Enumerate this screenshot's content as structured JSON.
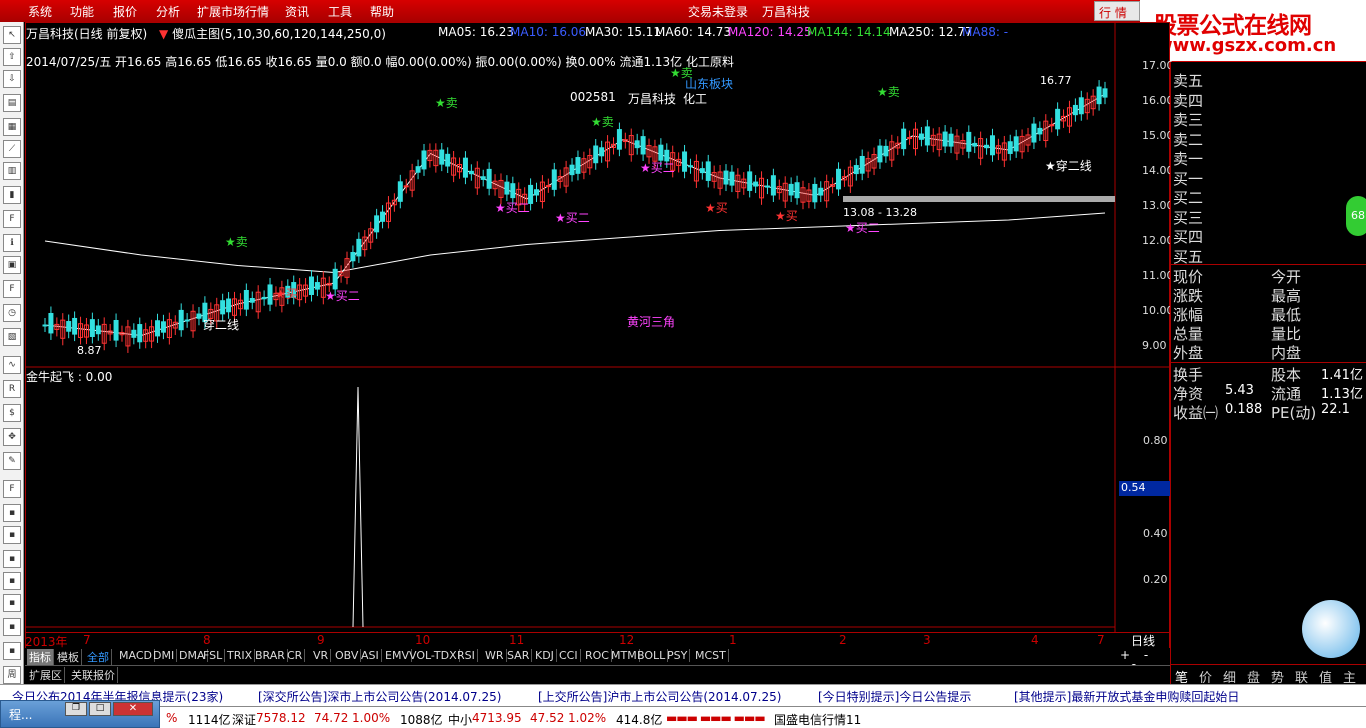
{
  "menu": [
    "系统",
    "功能",
    "报价",
    "分析",
    "扩展市场行情",
    "资讯",
    "工具",
    "帮助"
  ],
  "login_status": "交易未登录",
  "company": "万昌科技",
  "window_button": "行 情",
  "logo": {
    "title": "股票公式在线网",
    "url": "www.gszx.com.cn"
  },
  "chart": {
    "title": "万昌科技(日线 前复权)",
    "indicator": "傻瓜主图(5,10,30,60,120,144,250,0)",
    "ma": [
      {
        "label": "MA05: 16.23",
        "color": "#ffffff"
      },
      {
        "label": "MA10: 16.06",
        "color": "#3a5cff"
      },
      {
        "label": "MA30: 15.11",
        "color": "#ffffff"
      },
      {
        "label": "MA60: 14.73",
        "color": "#ffffff"
      },
      {
        "label": "MA120: 14.25",
        "color": "#ff44ff"
      },
      {
        "label": "MA144: 14.14",
        "color": "#33dd33"
      },
      {
        "label": "MA250: 12.77",
        "color": "#ffffff"
      },
      {
        "label": "MA88: -",
        "color": "#3a5cff"
      }
    ],
    "info_line": "2014/07/25/五 开16.65 高16.65 低16.65 收16.65 量0.0 额0.0 幅0.00(0.00%) 振0.00(0.00%) 换0.00% 流通1.13亿 化工原料",
    "stock_code": "002581",
    "stock_name": "万昌科技",
    "sector": "化工",
    "sector_block": "山东板块",
    "annotations": [
      "黄河三角",
      "穿二线",
      "13.08 - 13.28",
      "16.77",
      "8.87"
    ],
    "price_axis": [
      "17.00",
      "16.00",
      "15.00",
      "14.00",
      "13.00",
      "12.00",
      "11.00",
      "10.00",
      "9.00"
    ],
    "sub_indicator": "金牛起飞 : 0.00",
    "sub_axis": [
      "0.80",
      "0.60",
      "0.40",
      "0.20"
    ],
    "sub_value": "0.54",
    "x_labels": [
      "2013年",
      "7",
      "8",
      "9",
      "10",
      "11",
      "12",
      "1",
      "2",
      "3",
      "4",
      "7"
    ],
    "period": "日线"
  },
  "chart_data": {
    "type": "line",
    "title": "",
    "xlabel": "",
    "ylabel": "",
    "ylim": [
      8.5,
      17.5
    ],
    "x": [
      "2013-06",
      "2013-07",
      "2013-08",
      "2013-09",
      "2013-10",
      "2013-11",
      "2013-12",
      "2014-01",
      "2014-02",
      "2014-03",
      "2014-04",
      "2014-07"
    ],
    "series": [
      {
        "name": "MA05",
        "values": [
          9.6,
          9.3,
          10.2,
          10.8,
          14.5,
          13.2,
          14.9,
          13.8,
          13.3,
          15.0,
          14.6,
          16.2
        ]
      },
      {
        "name": "MA250",
        "values": [
          12.0,
          11.6,
          11.3,
          11.1,
          11.6,
          11.9,
          12.1,
          12.3,
          12.4,
          12.5,
          12.6,
          12.8
        ]
      }
    ],
    "signals": [
      "卖",
      "买二",
      "买",
      "穿二线"
    ]
  },
  "tabs": [
    "指标",
    "模板",
    "全部",
    "MACD",
    "DMI",
    "DMA",
    "FSL",
    "TRIX",
    "BRAR",
    "CR",
    "VR",
    "OBV",
    "ASI",
    "EMV",
    "VOL-TDX",
    "RSI",
    "WR",
    "SAR",
    "KDJ",
    "CCI",
    "ROC",
    "MTM",
    "BOLL",
    "PSY",
    "MCST"
  ],
  "expand": [
    "扩展区",
    "关联报价"
  ],
  "right_panel": {
    "order_book": [
      "卖五",
      "卖四",
      "卖三",
      "卖二",
      "卖一",
      "买一",
      "买二",
      "买三",
      "买四",
      "买五"
    ],
    "quote_left": [
      "现价",
      "涨跌",
      "涨幅",
      "总量",
      "外盘"
    ],
    "quote_right": [
      "今开",
      "最高",
      "最低",
      "量比",
      "内盘"
    ],
    "extra": [
      {
        "l": "换手",
        "m": "股本",
        "v": "1.41亿"
      },
      {
        "l": "净资",
        "lv": "5.43",
        "m": "流通",
        "v": "1.13亿"
      },
      {
        "l": "收益㈠",
        "lv": "0.188",
        "m": "PE(动)",
        "v": "22.1"
      }
    ],
    "bottom_tabs": [
      "笔",
      "价",
      "细",
      "盘",
      "势",
      "联",
      "值",
      "主"
    ],
    "badge": "68"
  },
  "news": [
    "今日公布2014年半年报信息提示(23家)",
    "[深交所公告]深市上市公司公告(2014.07.25)",
    "[上交所公告]沪市上市公司公告(2014.07.25)",
    "[今日特别提示]今日公告提示",
    "[其他提示]最新开放式基金申购赎回起始日"
  ],
  "status": {
    "sz_label": "深证",
    "sz_value": "7578.12",
    "sz_change": "74.72",
    "sz_pct": "1.00%",
    "sz_amount": "1088亿",
    "zx_label": "中小",
    "zx_value": "4713.95",
    "zx_change": "47.52",
    "zx_pct": "1.02%",
    "zx_amount": "414.8亿",
    "sh_amount": "1114亿",
    "sh_pct": "%",
    "server": "国盛电信行情11"
  },
  "float_window": "程..."
}
